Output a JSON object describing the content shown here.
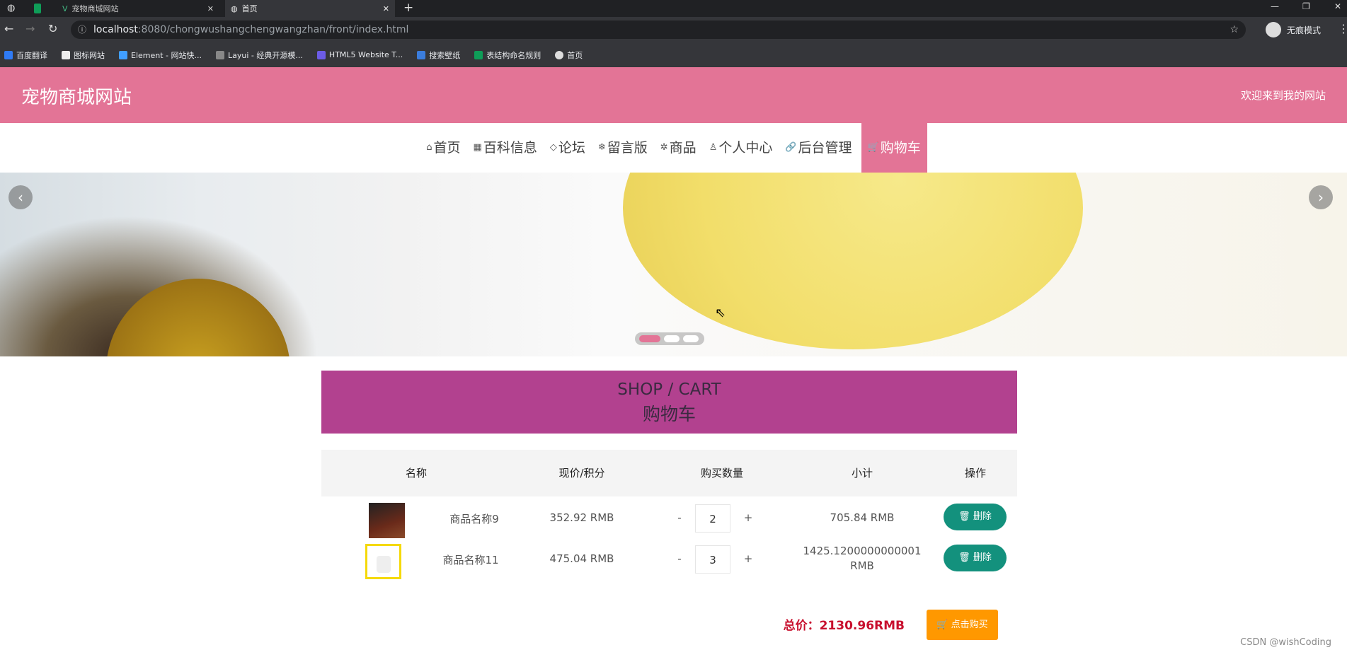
{
  "browser": {
    "tabs": [
      {
        "title": "宠物商城网站",
        "active": false
      },
      {
        "title": "首页",
        "active": true
      }
    ],
    "url_host": "localhost",
    "url_rest": ":8080/chongwushangchengwangzhan/front/index.html",
    "profile_label": "无痕模式",
    "bookmarks": [
      {
        "label": "百度翻译",
        "color": "#2f7bf5"
      },
      {
        "label": "图标网站",
        "color": "#111111"
      },
      {
        "label": "Element - 网站快...",
        "color": "#409eff"
      },
      {
        "label": "Layui - 经典开源模...",
        "color": "#35363a"
      },
      {
        "label": "HTML5 Website T...",
        "color": "#6c5ce7"
      },
      {
        "label": "搜索壁纸",
        "color": "#3b7ddd"
      },
      {
        "label": "表结构命名规则",
        "color": "#0f9d58"
      },
      {
        "label": "首页",
        "color": "#dddddd"
      }
    ]
  },
  "header": {
    "site_title": "宠物商城网站",
    "welcome": "欢迎来到我的网站",
    "bg_color": "#e37496"
  },
  "nav": {
    "items": [
      {
        "icon": "home-icon",
        "glyph": "⌂",
        "label": "首页"
      },
      {
        "icon": "grid-icon",
        "glyph": "▦",
        "label": "百科信息"
      },
      {
        "icon": "tag-icon",
        "glyph": "◇",
        "label": "论坛"
      },
      {
        "icon": "snowflake-icon",
        "glyph": "❄",
        "label": "留言版"
      },
      {
        "icon": "goods-icon",
        "glyph": "✲",
        "label": "商品"
      },
      {
        "icon": "user-icon",
        "glyph": "♙",
        "label": "个人中心"
      },
      {
        "icon": "link-icon",
        "glyph": "🔗",
        "label": "后台管理"
      },
      {
        "icon": "cart-icon",
        "glyph": "🛒",
        "label": "购物车",
        "active": true
      }
    ]
  },
  "carousel": {
    "slides": 3,
    "active_index": 0
  },
  "cart": {
    "title_en": "SHOP / CART",
    "title_cn": "购物车",
    "columns": [
      "名称",
      "现价/积分",
      "购买数量",
      "小计",
      "操作"
    ],
    "rows": [
      {
        "name": "商品名称9",
        "price": "352.92 RMB",
        "qty": "2",
        "subtotal": "705.84 RMB",
        "subtotal2": "",
        "delete_label": "删除"
      },
      {
        "name": "商品名称11",
        "price": "475.04 RMB",
        "qty": "3",
        "subtotal": "1425.1200000000001",
        "subtotal2": "RMB",
        "delete_label": "删除"
      }
    ],
    "minus": "-",
    "plus": "+",
    "total_label": "总价：2130.96RMB",
    "buy_label": "点击购买",
    "accent_delete": "#13917d",
    "accent_buy": "#ff9800",
    "total_color": "#c8102e"
  },
  "watermark": "CSDN @wishCoding"
}
